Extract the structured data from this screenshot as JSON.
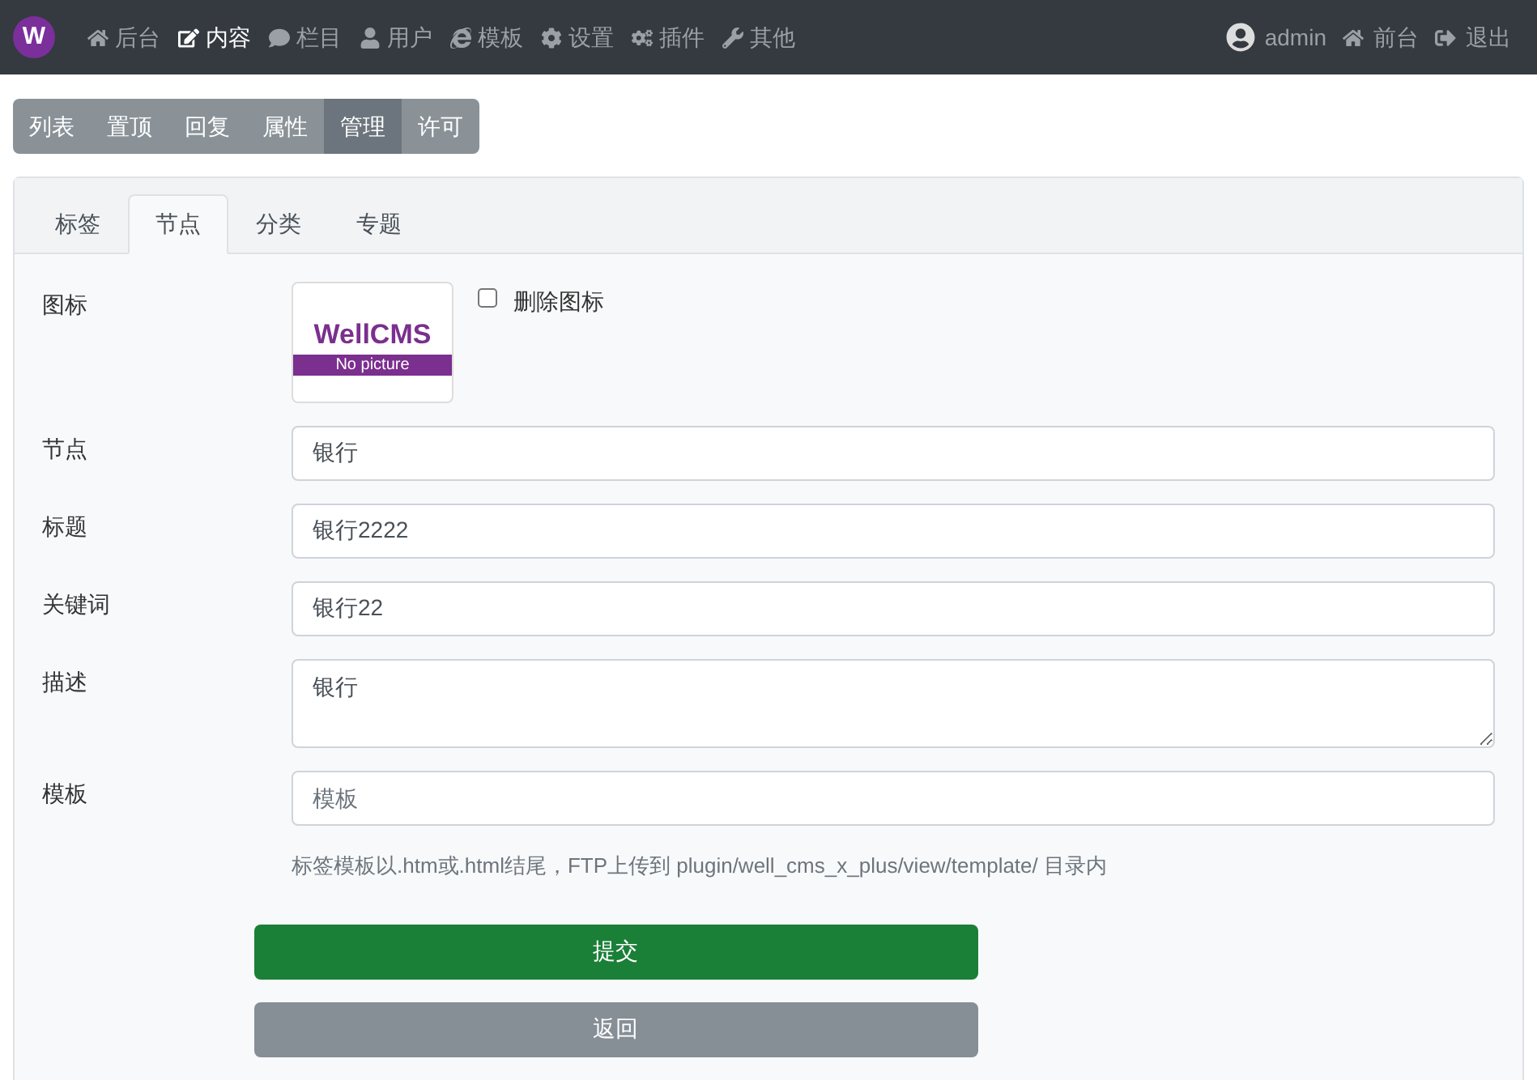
{
  "navbar": {
    "logo": "W",
    "items": [
      {
        "label": "后台",
        "kind": "home",
        "selected": false
      },
      {
        "label": "内容",
        "kind": "edit",
        "selected": true
      },
      {
        "label": "栏目",
        "kind": "comment",
        "selected": false
      },
      {
        "label": "用户",
        "kind": "user",
        "selected": false
      },
      {
        "label": "模板",
        "kind": "ie",
        "selected": false
      },
      {
        "label": "设置",
        "kind": "gear",
        "selected": false
      },
      {
        "label": "插件",
        "kind": "gears",
        "selected": false
      },
      {
        "label": "其他",
        "kind": "wrench",
        "selected": false
      }
    ],
    "right": [
      {
        "label": "admin",
        "kind": "avatar"
      },
      {
        "label": "前台",
        "kind": "home"
      },
      {
        "label": "退出",
        "kind": "signout"
      }
    ]
  },
  "subnav": [
    {
      "label": "列表",
      "selected": false
    },
    {
      "label": "置顶",
      "selected": false
    },
    {
      "label": "回复",
      "selected": false
    },
    {
      "label": "属性",
      "selected": false
    },
    {
      "label": "管理",
      "selected": true
    },
    {
      "label": "许可",
      "selected": false
    }
  ],
  "tabs": [
    {
      "label": "标签",
      "selected": false
    },
    {
      "label": "节点",
      "selected": true
    },
    {
      "label": "分类",
      "selected": false
    },
    {
      "label": "专题",
      "selected": false
    }
  ],
  "form": [
    {
      "kind": "image",
      "label": "图标",
      "brand": "WellCMS",
      "caption": "No picture",
      "checkbox": {
        "label": "删除图标",
        "checked": false
      }
    },
    {
      "kind": "text",
      "label": "节点",
      "value": "银行"
    },
    {
      "kind": "text",
      "label": "标题",
      "value": "银行2222"
    },
    {
      "kind": "text",
      "label": "关键词",
      "value": "银行22"
    },
    {
      "kind": "textarea",
      "label": "描述",
      "value": "银行"
    },
    {
      "kind": "text",
      "label": "模板",
      "placeholder": "模板",
      "hint": "标签模板以.htm或.html结尾，FTP上传到 plugin/well_cms_x_plus/view/template/ 目录内"
    }
  ],
  "buttons": [
    {
      "label": "提交",
      "kind": "primary"
    },
    {
      "label": "返回",
      "kind": "secondary"
    }
  ]
}
